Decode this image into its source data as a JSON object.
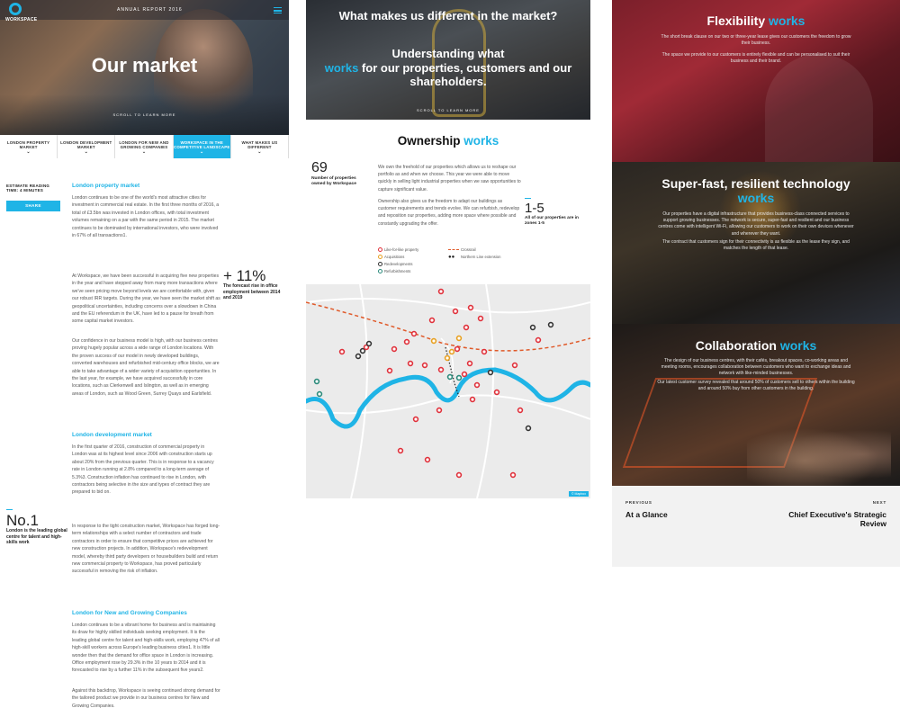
{
  "col1": {
    "logo_text": "WORKSPACE",
    "annual_report": "ANNUAL REPORT 2016",
    "hero_title": "Our market",
    "scroll_label": "SCROLL TO LEARN MORE",
    "tabs": [
      {
        "label": "LONDON PROPERTY MARKET"
      },
      {
        "label": "LONDON DEVELOPMENT MARKET"
      },
      {
        "label": "LONDON FOR NEW AND GROWING COMPANIES"
      },
      {
        "label": "WORKSPACE IN THE COMPETITIVE LANDSCAPE"
      },
      {
        "label": "WHAT MAKES US DIFFERENT"
      }
    ],
    "active_tab_index": 3,
    "reading_time": "ESTIMATE READING TIME: 4 MINUTES",
    "share_label": "SHARE",
    "sections": [
      {
        "heading": "London property market",
        "paragraphs": [
          "London continues to be one of the world's most attractive cities for investment in commercial real estate. In the first three months of 2016, a total of £3.5bn was invested in London offices, with total investment volumes remaining on a par with the same period in 2015. The market continues to be dominated by international investors, who were involved in 67% of all transactions1.",
          "At Workspace, we have been successful in acquiring five new properties in the year and have stepped away from many more transactions where we've seen pricing move beyond levels we are comfortable with, given our robust IRR targets. During the year, we have seen the market shift as geopolitical uncertainties, including concerns over a slowdown in China and the EU referendum in the UK, have led to a pause for breath from some capital market investors.",
          "Our confidence in our business model is high, with our business centres proving hugely popular across a wide range of London locations. With the proven success of our model in newly developed buildings, converted warehouses and refurbished mid-century office blocks, we are able to take advantage of a wider variety of acquisition opportunities. In the last year, for example, we have acquired successfully in core locations, such as Clerkenwell and Islington, as well as in emerging areas of London, such as Wood Green, Surrey Quays and Earlsfield."
        ]
      },
      {
        "heading": "London development market",
        "paragraphs": [
          "In the first quarter of 2016, construction of commercial property in London was at its highest level since 2006 with construction starts up about 20% from the previous quarter. This is in response to a vacancy rate in London running at 2.8% compared to a long-term average of 5.3%3. Construction inflation has continued to rise in London, with contractors being selective in the size and types of contract they are prepared to bid on.",
          "In response to the tight construction market, Workspace has forged long-term relationships with a select number of contractors and trade contractors in order to ensure that competitive prices are achieved for new construction projects. In addition, Workspace's redevelopment model, whereby third party developers or housebuilders build and return new commercial property to Workspace, has proved particularly successful in removing the risk of inflation."
        ]
      },
      {
        "heading": "London for New and Growing Companies",
        "paragraphs": [
          "London continues to be a vibrant home for business and is maintaining its draw for highly skilled individuals seeking employment. It is the leading global centre for talent and high-skills work, employing 47% of all high-skill workers across Europe's leading business cities1. It is little wonder then that the demand for office space in London is increasing. Office employment rose by 29.3% in the 10 years to 2014 and it is forecasted to rise by a further 11% in the subsequent five years2.",
          "Against this backdrop, Workspace is seeing continued strong demand for the tailored product we provide in our business centres for New and Growing Companies."
        ]
      }
    ],
    "stats": [
      {
        "value": "+ 11%",
        "label": "The forecast rise in office employment between 2014 and 2019"
      },
      {
        "value": "No.1",
        "label": "London is the leading global centre for talent and high-skills work"
      }
    ]
  },
  "col2": {
    "question": "What makes us different in the market?",
    "answer_pre": "Understanding what",
    "answer_accent": "works",
    "answer_post": "for our properties, customers and our shareholders.",
    "scroll_label": "SCROLL TO LEARN MORE",
    "ownership_title": "Ownership",
    "ownership_accent": "works",
    "stat_owned": {
      "value": "69",
      "label": "Number of properties owned by Workspace"
    },
    "paragraphs": [
      "We own the freehold of our properties which allows us to reshape our portfolio as and when we choose. This year we were able to move quickly in selling light industrial properties when we saw opportunities to capture significant value.",
      "Ownership also gives us the freedom to adapt our buildings as customer requirements and trends evolve. We can refurbish, redevelop and reposition our properties, adding more space where possible and constantly upgrading the offer."
    ],
    "stat_zones": {
      "value": "1-5",
      "label": "All of our properties are in zones 1-5"
    },
    "legend": [
      {
        "label": "Like-for-like property",
        "color": "#e0303a"
      },
      {
        "label": "Acquisitions",
        "color": "#e8a020"
      },
      {
        "label": "Redevelopments",
        "color": "#333333"
      },
      {
        "label": "Refurbishments",
        "color": "#2a8a7a"
      },
      {
        "label": "Crossrail",
        "color": "#e05a2a"
      },
      {
        "label": "Northern Line extension",
        "color": "#222222"
      }
    ],
    "map_badge": "© Mapbox"
  },
  "col3": {
    "panels": [
      {
        "title": "Flexibility",
        "accent": "works",
        "text": [
          "The short break clause on our two or three-year lease gives our customers the freedom to grow their business.",
          "The space we provide to our customers is entirely flexible and can be personalised to suit their business and their brand."
        ]
      },
      {
        "title": "Super-fast, resilient technology",
        "accent": "works",
        "text": [
          "Our properties have a digital infrastructure that provides business-class connected services to support growing businesses. The network is secure, super-fast and resilient and our business centres come with intelligent Wi-Fi, allowing our customers to work on their own devices whenever and wherever they want.",
          "The contract that customers sign for their connectivity is as flexible as the lease they sign, and matches the length of that lease."
        ]
      },
      {
        "title": "Collaboration",
        "accent": "works",
        "text": [
          "The design of our business centres, with their cafés, breakout spaces, co-working areas and meeting rooms, encourages collaboration between customers who want to exchange ideas and network with like-minded businesses.",
          "Our latest customer survey revealed that around 50% of customers sell to others within the building and around 50% buy from other customers in the building."
        ]
      }
    ],
    "previous_label": "PREVIOUS",
    "previous_title": "At a Glance",
    "next_label": "NEXT",
    "next_title": "Chief Executive's Strategic Review"
  }
}
